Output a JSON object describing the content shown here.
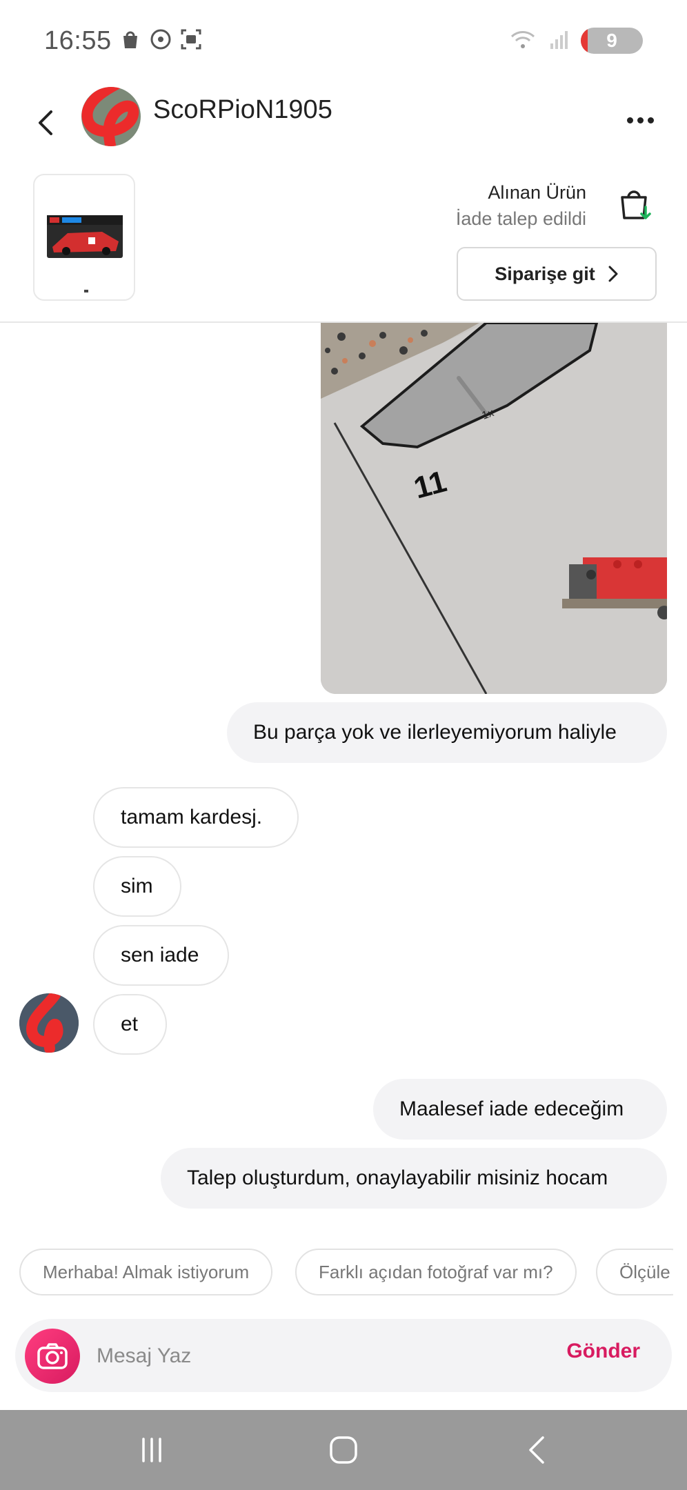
{
  "status_bar": {
    "time": "16:55",
    "battery": "9"
  },
  "header": {
    "username": "ScoRPioN1905"
  },
  "product": {
    "title": "Alınan Ürün",
    "status": "İade talep edildi",
    "order_button_label": "Siparişe git"
  },
  "messages": [
    {
      "direction": "out",
      "text": "Bu parça yok ve ilerleyemiyorum haliyle"
    },
    {
      "direction": "in",
      "text": "tamam kardesj."
    },
    {
      "direction": "in",
      "text": "sim"
    },
    {
      "direction": "in",
      "text": "sen iade"
    },
    {
      "direction": "in",
      "text": "et"
    },
    {
      "direction": "out",
      "text": "Maalesef iade edeceğim"
    },
    {
      "direction": "out",
      "text": "Talep oluşturdum, onaylayabilir misiniz hocam"
    }
  ],
  "image_message": {
    "step_number": "11",
    "part_count": "1x"
  },
  "quick_replies": [
    "Merhaba! Almak istiyorum",
    "Farklı açıdan fotoğraf var mı?",
    "Ölçüle"
  ],
  "composer": {
    "placeholder": "Mesaj Yaz",
    "send_label": "Gönder"
  },
  "colors": {
    "accent": "#d81b60",
    "bubble_out": "#f3f3f5",
    "nav_bar": "#9a9a9a"
  }
}
